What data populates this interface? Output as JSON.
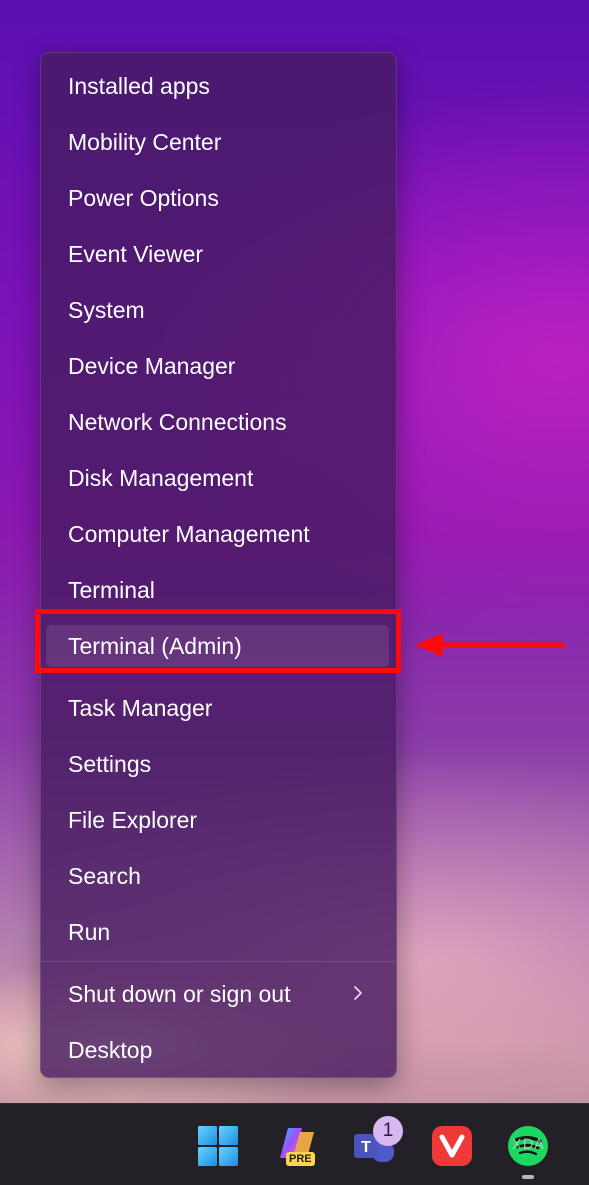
{
  "menu": {
    "items": [
      {
        "label": "Installed apps"
      },
      {
        "label": "Mobility Center"
      },
      {
        "label": "Power Options"
      },
      {
        "label": "Event Viewer"
      },
      {
        "label": "System"
      },
      {
        "label": "Device Manager"
      },
      {
        "label": "Network Connections"
      },
      {
        "label": "Disk Management"
      },
      {
        "label": "Computer Management"
      },
      {
        "label": "Terminal"
      },
      {
        "label": "Terminal (Admin)",
        "selected": true
      },
      {
        "label": "Task Manager"
      },
      {
        "label": "Settings"
      },
      {
        "label": "File Explorer"
      },
      {
        "label": "Search"
      },
      {
        "label": "Run"
      },
      {
        "label": "Shut down or sign out",
        "submenu": true
      },
      {
        "label": "Desktop"
      }
    ]
  },
  "annotation": {
    "color": "#ff0a0a",
    "highlighted_item": "Terminal (Admin)"
  },
  "taskbar": {
    "icons": [
      "windows-start-icon",
      "copilot-pre-icon",
      "teams-icon",
      "vivaldi-icon",
      "spotify-icon"
    ],
    "copilot_badge": "PRE",
    "teams_badge_count": "1",
    "watermark": "XDA"
  }
}
